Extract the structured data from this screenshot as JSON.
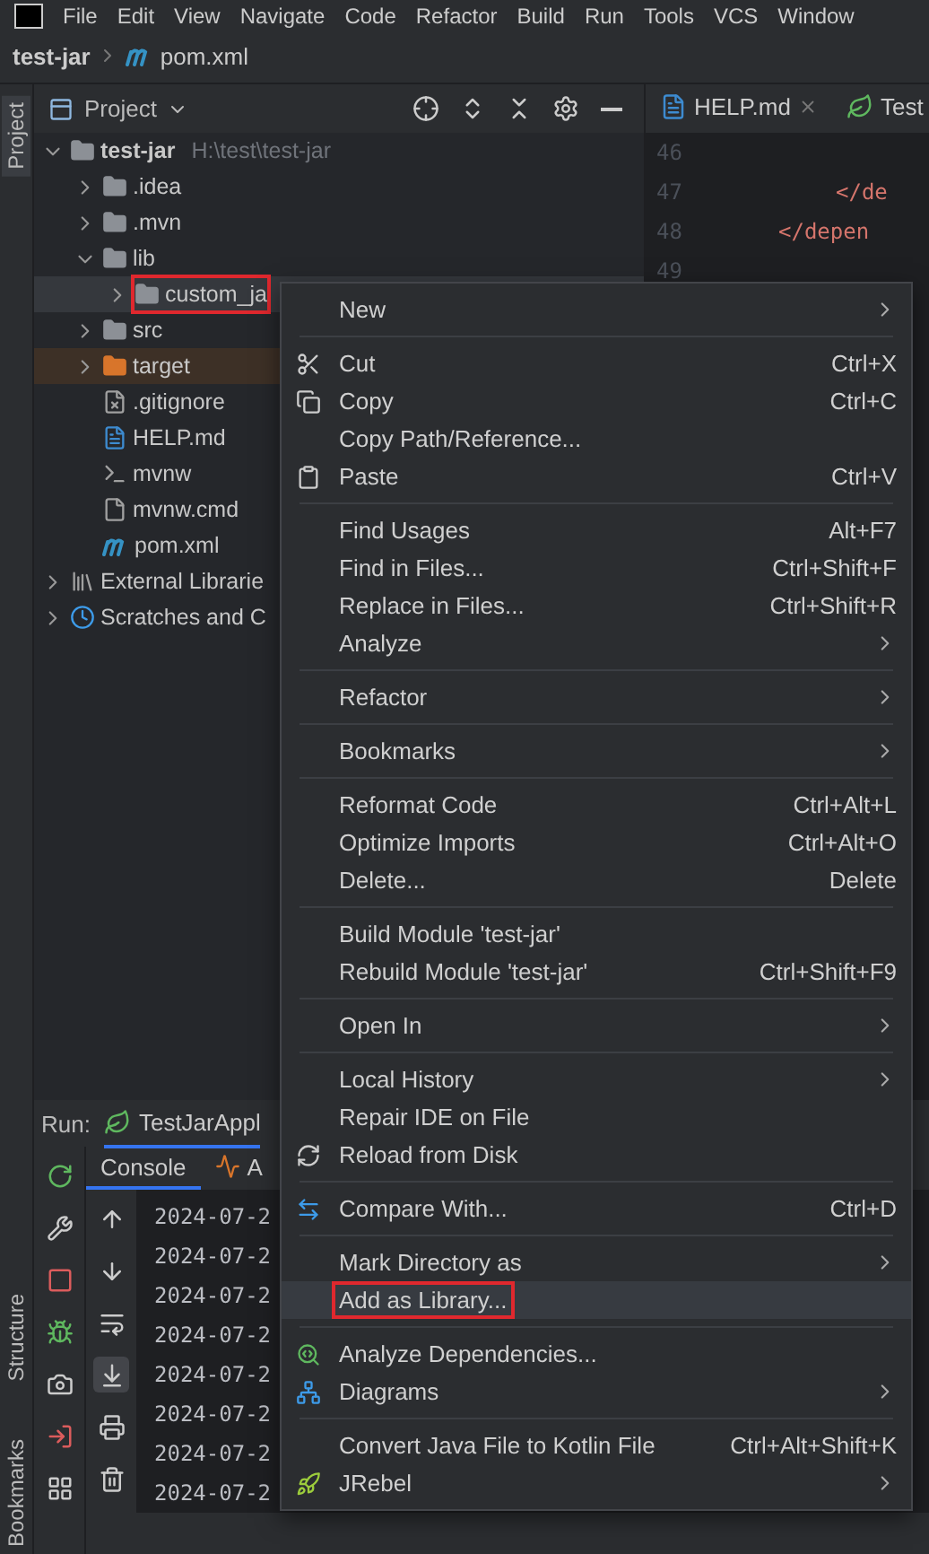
{
  "menubar": {
    "items": [
      "File",
      "Edit",
      "View",
      "Navigate",
      "Code",
      "Refactor",
      "Build",
      "Run",
      "Tools",
      "VCS",
      "Window"
    ]
  },
  "breadcrumb": {
    "project": "test-jar",
    "file": "pom.xml"
  },
  "left_stripe": {
    "top": [
      {
        "label": "Project",
        "selected": true
      }
    ],
    "bottom": [
      {
        "label": "Structure",
        "selected": false
      },
      {
        "label": "Bookmarks",
        "selected": false
      }
    ]
  },
  "project_panel": {
    "title": "Project",
    "tree": [
      {
        "label": "test-jar",
        "hint": "H:\\test\\test-jar",
        "kind": "module",
        "expanded": true,
        "selected": false,
        "children": [
          {
            "label": ".idea",
            "kind": "folder",
            "expanded": false,
            "selected": false
          },
          {
            "label": ".mvn",
            "kind": "folder",
            "expanded": false,
            "selected": false
          },
          {
            "label": "lib",
            "kind": "folder",
            "expanded": true,
            "selected": false,
            "children": [
              {
                "label": "custom_ja",
                "kind": "folder",
                "expanded": false,
                "selected": true,
                "annotated": true
              }
            ]
          },
          {
            "label": "src",
            "kind": "folder",
            "expanded": false,
            "selected": false
          },
          {
            "label": "target",
            "kind": "excluded",
            "expanded": false,
            "selected": false
          },
          {
            "label": ".gitignore",
            "kind": "ignore",
            "selected": false
          },
          {
            "label": "HELP.md",
            "kind": "markdown",
            "selected": false
          },
          {
            "label": "mvnw",
            "kind": "shell",
            "selected": false
          },
          {
            "label": "mvnw.cmd",
            "kind": "text",
            "selected": false
          },
          {
            "label": "pom.xml",
            "kind": "maven",
            "selected": false
          }
        ]
      },
      {
        "label": "External Librarie",
        "kind": "libraries",
        "expanded": false,
        "selected": false
      },
      {
        "label": "Scratches and C",
        "kind": "scratches",
        "expanded": false,
        "selected": false
      }
    ]
  },
  "editor": {
    "tabs": [
      {
        "label": "HELP.md",
        "closable": true,
        "selected": false
      },
      {
        "label": "Test",
        "closable": false,
        "selected": false
      }
    ],
    "lines": [
      {
        "number": "46"
      },
      {
        "number": "47",
        "text": "</de"
      },
      {
        "number": "48",
        "text": "</depen"
      },
      {
        "number": "49"
      }
    ]
  },
  "run_panel": {
    "label": "Run:",
    "tab": "TestJarAppl",
    "console_tools": [
      {
        "selected": false
      },
      {
        "selected": false
      },
      {
        "selected": false
      },
      {
        "selected": true
      },
      {
        "selected": false
      },
      {
        "selected": false
      }
    ],
    "tabs": [
      {
        "label": "Console",
        "selected": true
      },
      {
        "label": "A",
        "selected": false
      }
    ],
    "log": [
      "2024-07-2",
      "2024-07-2",
      "2024-07-2",
      "2024-07-2",
      "2024-07-2",
      "2024-07-2",
      "2024-07-2",
      "2024-07-2"
    ]
  },
  "context_menu": {
    "items": [
      {
        "kind": "item",
        "label": "New",
        "submenu": true,
        "selected": false
      },
      {
        "kind": "separator"
      },
      {
        "kind": "item",
        "label": "Cut",
        "shortcut": "Ctrl+X",
        "selected": false
      },
      {
        "kind": "item",
        "label": "Copy",
        "shortcut": "Ctrl+C",
        "selected": false
      },
      {
        "kind": "item",
        "label": "Copy Path/Reference...",
        "selected": false
      },
      {
        "kind": "item",
        "label": "Paste",
        "shortcut": "Ctrl+V",
        "selected": false
      },
      {
        "kind": "separator"
      },
      {
        "kind": "item",
        "label": "Find Usages",
        "shortcut": "Alt+F7",
        "selected": false
      },
      {
        "kind": "item",
        "label": "Find in Files...",
        "shortcut": "Ctrl+Shift+F",
        "selected": false
      },
      {
        "kind": "item",
        "label": "Replace in Files...",
        "shortcut": "Ctrl+Shift+R",
        "selected": false
      },
      {
        "kind": "item",
        "label": "Analyze",
        "submenu": true,
        "selected": false
      },
      {
        "kind": "separator"
      },
      {
        "kind": "item",
        "label": "Refactor",
        "submenu": true,
        "selected": false
      },
      {
        "kind": "separator"
      },
      {
        "kind": "item",
        "label": "Bookmarks",
        "submenu": true,
        "selected": false
      },
      {
        "kind": "separator"
      },
      {
        "kind": "item",
        "label": "Reformat Code",
        "shortcut": "Ctrl+Alt+L",
        "selected": false
      },
      {
        "kind": "item",
        "label": "Optimize Imports",
        "shortcut": "Ctrl+Alt+O",
        "selected": false
      },
      {
        "kind": "item",
        "label": "Delete...",
        "shortcut": "Delete",
        "selected": false
      },
      {
        "kind": "separator"
      },
      {
        "kind": "item",
        "label": "Build Module 'test-jar'",
        "selected": false
      },
      {
        "kind": "item",
        "label": "Rebuild Module 'test-jar'",
        "shortcut": "Ctrl+Shift+F9",
        "selected": false
      },
      {
        "kind": "separator"
      },
      {
        "kind": "item",
        "label": "Open In",
        "submenu": true,
        "selected": false
      },
      {
        "kind": "separator"
      },
      {
        "kind": "item",
        "label": "Local History",
        "submenu": true,
        "selected": false
      },
      {
        "kind": "item",
        "label": "Repair IDE on File",
        "selected": false
      },
      {
        "kind": "item",
        "label": "Reload from Disk",
        "selected": false
      },
      {
        "kind": "separator"
      },
      {
        "kind": "item",
        "label": "Compare With...",
        "shortcut": "Ctrl+D",
        "selected": false
      },
      {
        "kind": "separator"
      },
      {
        "kind": "item",
        "label": "Mark Directory as",
        "submenu": true,
        "selected": false
      },
      {
        "kind": "item",
        "label": "Add as Library...",
        "selected": true,
        "annotated": true
      },
      {
        "kind": "separator"
      },
      {
        "kind": "item",
        "label": "Analyze Dependencies...",
        "selected": false
      },
      {
        "kind": "item",
        "label": "Diagrams",
        "submenu": true,
        "selected": false
      },
      {
        "kind": "separator"
      },
      {
        "kind": "item",
        "label": "Convert Java File to Kotlin File",
        "shortcut": "Ctrl+Alt+Shift+K",
        "selected": false
      },
      {
        "kind": "item",
        "label": "JRebel",
        "submenu": true,
        "selected": false
      }
    ]
  }
}
